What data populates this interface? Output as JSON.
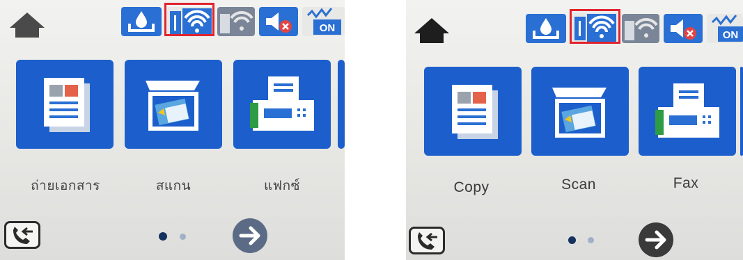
{
  "screens": [
    {
      "id": "thai",
      "status_bar": [
        "home-icon",
        "ink-icon",
        "wifi-icon",
        "wifi-direct-icon",
        "quiet-mode-icon",
        "power-saving-icon"
      ],
      "highlighted_status": "wifi-icon",
      "tiles": [
        {
          "icon": "copy-icon",
          "label": "ถ่ายเอกสาร"
        },
        {
          "icon": "scan-icon",
          "label": "สแกน"
        },
        {
          "icon": "fax-icon",
          "label": "แฟกซ์"
        }
      ],
      "on_badge": "ON",
      "page_indicator": {
        "current": 1,
        "total": 2
      }
    },
    {
      "id": "english",
      "status_bar": [
        "home-icon",
        "ink-icon",
        "wifi-icon",
        "wifi-direct-icon",
        "quiet-mode-icon",
        "power-saving-icon"
      ],
      "highlighted_status": "wifi-icon",
      "tiles": [
        {
          "icon": "copy-icon",
          "label": "Copy"
        },
        {
          "icon": "scan-icon",
          "label": "Scan"
        },
        {
          "icon": "fax-icon",
          "label": "Fax"
        }
      ],
      "on_badge": "ON",
      "page_indicator": {
        "current": 1,
        "total": 2
      }
    }
  ],
  "colors": {
    "tile_blue": "#1c5fcc",
    "status_blue": "#2a6fd3",
    "highlight_red": "#e0242f",
    "arrow_button": "#5c6b85"
  }
}
